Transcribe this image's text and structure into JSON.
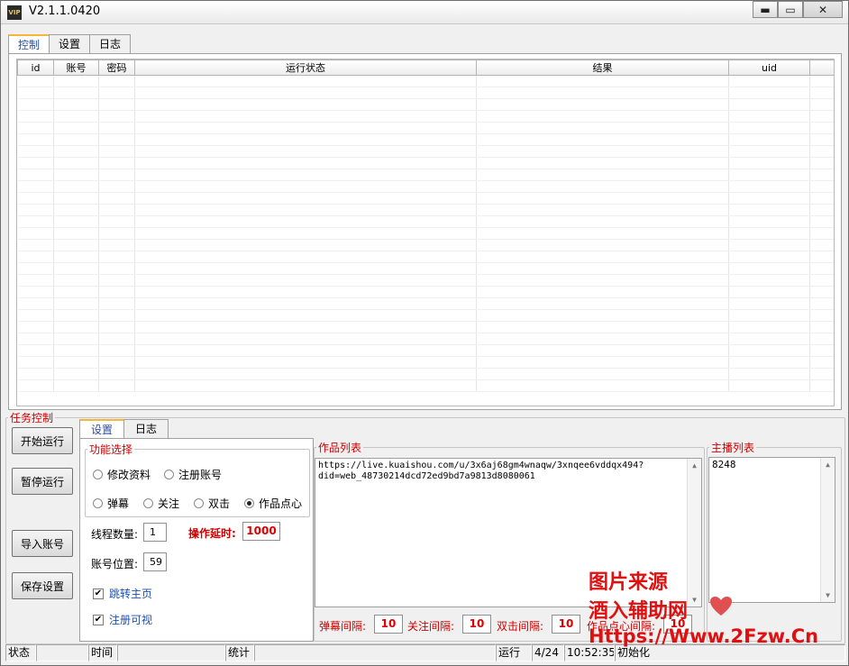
{
  "window": {
    "icon_text": "VIP",
    "title": "V2.1.1.0420",
    "minimize": "▬",
    "maximize": "▭",
    "close": "✕"
  },
  "main_tabs": [
    {
      "label": "控制"
    },
    {
      "label": "设置"
    },
    {
      "label": "日志"
    }
  ],
  "grid": {
    "columns": [
      "id",
      "账号",
      "密码",
      "运行状态",
      "结果",
      "uid"
    ]
  },
  "task": {
    "legend": "任务控制",
    "buttons": {
      "start": "开始运行",
      "pause": "暂停运行",
      "import": "导入账号",
      "save": "保存设置"
    },
    "subtabs": [
      {
        "label": "设置"
      },
      {
        "label": "日志"
      }
    ],
    "func": {
      "legend": "功能选择",
      "options": [
        "修改资料",
        "注册账号",
        "弹幕",
        "关注",
        "双击",
        "作品点心"
      ],
      "selected": "作品点心"
    },
    "threads_label": "线程数量:",
    "threads_value": "1",
    "delay_label": "操作延时:",
    "delay_value": "1000",
    "position_label": "账号位置:",
    "position_value": "59",
    "jump_home": "跳转主页",
    "register_visible": "注册可视"
  },
  "works": {
    "legend": "作品列表",
    "content_line1": "https://live.kuaishou.com/u/3x6aj68gm4wnaqw/3xnqee6vddqx494?",
    "content_line2": "did=web_48730214dcd72ed9bd7a9813d8080061"
  },
  "anchors": {
    "legend": "主播列表",
    "content": "8248"
  },
  "intervals": [
    {
      "label": "弹幕间隔:",
      "value": "10"
    },
    {
      "label": "关注间隔:",
      "value": "10"
    },
    {
      "label": "双击间隔:",
      "value": "10"
    },
    {
      "label": "作品点心间隔:",
      "value": "10"
    }
  ],
  "status": {
    "status_label": "状态",
    "time_label": "时间",
    "stats_label": "统计",
    "run_label": "运行",
    "progress": "4/24",
    "clock": "10:52:35",
    "state": "初始化"
  },
  "watermark": {
    "line1": "图片来源",
    "line2": "酒入辅助网",
    "line3": "Https://Www.2Fzw.Cn"
  }
}
